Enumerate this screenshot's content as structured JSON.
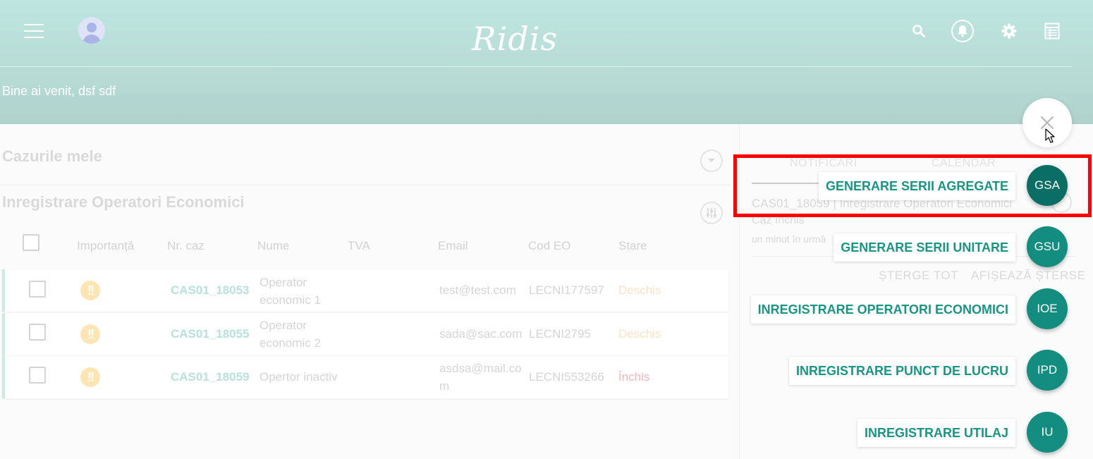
{
  "header": {
    "app_title": "Ridis",
    "welcome": "Bine ai venit, dsf sdf",
    "icons": [
      "menu-icon",
      "avatar-icon",
      "search-icon",
      "bell-icon",
      "gear-icon",
      "table-icon"
    ]
  },
  "cases": {
    "title": "Cazurile mele",
    "subtitle": "Inregistrare Operatori Economici",
    "columns": [
      "Importanță",
      "Nr. caz",
      "Nume",
      "TVA",
      "Email",
      "Cod EO",
      "Stare"
    ],
    "rows": [
      {
        "case_no": "CAS01_18053",
        "name": "Operator economic 1",
        "tva": "",
        "email": "test@test.com",
        "code": "LECNI177597",
        "status": "Deschis"
      },
      {
        "case_no": "CAS01_18055",
        "name": "Operator economic 2",
        "tva": "",
        "email": "sada@sac.com",
        "code": "LECNI2795",
        "status": "Deschis"
      },
      {
        "case_no": "CAS01_18059",
        "name": "Opertor inactiv",
        "tva": "",
        "email": "asdsa@mail.com",
        "code": "LECNI553266",
        "status": "Închis"
      }
    ]
  },
  "notifications": {
    "tabs": [
      "NOTIFICĂRI",
      "CALENDAR"
    ],
    "item": {
      "title": "CAS01_18059 | Inregistrare Operatori Economici",
      "status": "Caz închis",
      "time": "un minut în urmă"
    },
    "clear_all": "ȘTERGE TOT",
    "show_deleted": "AFIȘEAZĂ ȘTERSE"
  },
  "speed_dial": {
    "items": [
      {
        "abbr": "GSA",
        "label": "GENERARE SERII AGREGATE"
      },
      {
        "abbr": "GSU",
        "label": "GENERARE SERII UNITARE"
      },
      {
        "abbr": "IOE",
        "label": "INREGISTRARE OPERATORI ECONOMICI"
      },
      {
        "abbr": "IPD",
        "label": "INREGISTRARE PUNCT DE LUCRU"
      },
      {
        "abbr": "IU",
        "label": "INREGISTRARE UTILAJ"
      }
    ]
  },
  "colors": {
    "header": "#b7dcd6",
    "fab": "#138d80",
    "fab_active": "#0b6e64",
    "label_text": "#179684",
    "highlight": "#ff0000"
  }
}
